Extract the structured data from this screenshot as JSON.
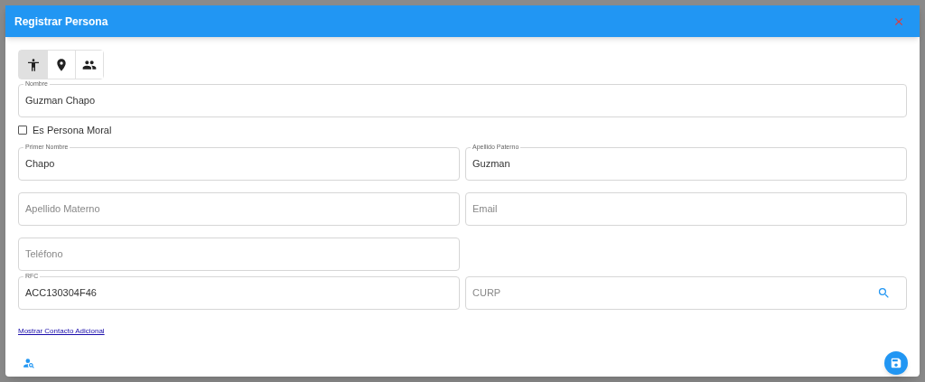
{
  "dialog": {
    "title": "Registrar Persona"
  },
  "tabs": [
    {
      "kind": "person",
      "selected": true
    },
    {
      "kind": "location",
      "selected": false
    },
    {
      "kind": "people",
      "selected": false
    }
  ],
  "nombre": {
    "label": "Nombre",
    "value": "Guzman Chapo"
  },
  "moral_checkbox": {
    "label": "Es Persona Moral",
    "checked": false
  },
  "rows": [
    [
      {
        "label": "Primer Nombre",
        "value": "Chapo"
      },
      {
        "label": "Apellido Paterno",
        "value": "Guzman"
      }
    ],
    [
      {
        "placeholder": "Apellido Materno"
      },
      {
        "placeholder": "Email"
      }
    ],
    [
      {
        "placeholder": "Teléfono"
      }
    ],
    [
      {
        "label": "RFC",
        "value": "ACC130304F46"
      },
      {
        "placeholder": "CURP",
        "search": true
      }
    ]
  ],
  "link": "Mostrar Contacto Adicional"
}
